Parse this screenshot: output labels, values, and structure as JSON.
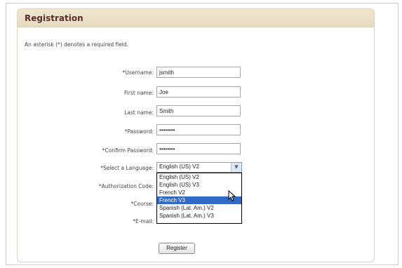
{
  "panel": {
    "title": "Registration",
    "required_note": "An asterisk (*) denotes a required field."
  },
  "form": {
    "username_label": "*Username:",
    "username_value": "jsmith",
    "first_name_label": "First name:",
    "first_name_value": "Joe",
    "last_name_label": "Last name:",
    "last_name_value": "Smith",
    "password_label": "*Password:",
    "password_value": "••••••••",
    "confirm_password_label": "*Confirm Password:",
    "confirm_password_value": "••••••••",
    "language_label": "*Select a Language:",
    "language_selected": "English (US) V2",
    "language_options": [
      "English (US) V2",
      "English (US) V3",
      "French V2",
      "French V3",
      "Spanish (Lat. Am.) V2",
      "Spanish (Lat. Am.) V3"
    ],
    "language_highlighted_index": 3,
    "authorization_code_label": "*Authorization Code:",
    "course_label": "*Course:",
    "email_label": "*E-mail:",
    "register_label": "Register"
  },
  "icons": {
    "select_arrow": "chevron-down-icon",
    "cursor": "mouse-pointer-icon"
  },
  "colors": {
    "header_bg": "#efe6d0",
    "title_text": "#5a2d2d",
    "selection_bg": "#316ac5"
  }
}
